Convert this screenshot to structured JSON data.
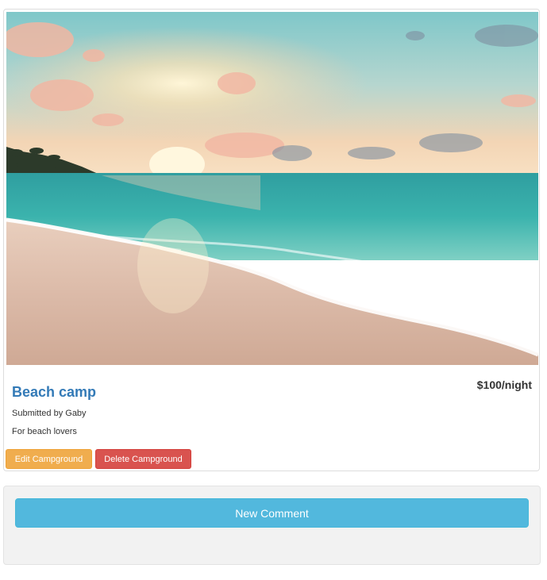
{
  "campground": {
    "image_alt": "Beach at sunset with waves on the sand",
    "price": "$100/night",
    "name": "Beach camp",
    "submitted_by": "Submitted by Gaby",
    "description": "For beach lovers"
  },
  "actions": {
    "edit_label": "Edit Campground",
    "delete_label": "Delete Campground"
  },
  "comments": {
    "new_comment_label": "New Comment"
  },
  "colors": {
    "title": "#337ab7",
    "edit": "#f0ad4e",
    "delete": "#d9534f",
    "comment": "#52b8dd"
  }
}
